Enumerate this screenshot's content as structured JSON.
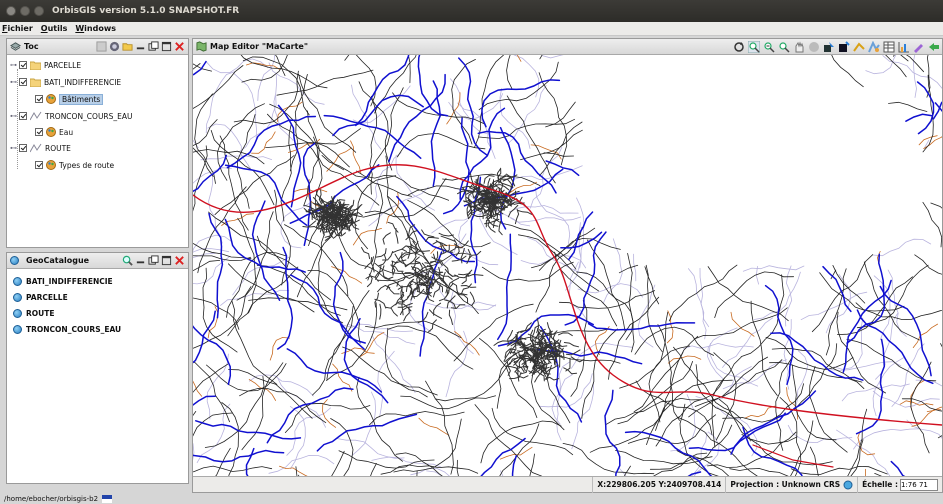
{
  "window": {
    "title": "OrbisGIS version 5.1.0 SNAPSHOT.FR"
  },
  "menu": [
    "Fichier",
    "Outils",
    "Windows"
  ],
  "toc": {
    "title": "Toc",
    "layers": [
      {
        "label": "PARCELLE",
        "level": 0,
        "kind": "folder"
      },
      {
        "label": "BATI_INDIFFERENCIE",
        "level": 0,
        "kind": "folder"
      },
      {
        "label": "Bâtiments",
        "level": 1,
        "kind": "style"
      },
      {
        "label": "TRONCON_COURS_EAU",
        "level": 0,
        "kind": "line"
      },
      {
        "label": "Eau",
        "level": 1,
        "kind": "style"
      },
      {
        "label": "ROUTE",
        "level": 0,
        "kind": "line"
      },
      {
        "label": "Types de route",
        "level": 1,
        "kind": "style"
      }
    ]
  },
  "geocatalogue": {
    "title": "GeoCatalogue",
    "sources": [
      "BATI_INDIFFERENCIE",
      "PARCELLE",
      "ROUTE",
      "TRONCON_COURS_EAU"
    ]
  },
  "map_editor": {
    "title": "Map Editor \"MaCarte\"",
    "tool_icons": [
      "refresh-icon",
      "zoom-in-icon",
      "zoom-out-icon",
      "zoom-extent-icon",
      "pan-icon",
      "info-icon",
      "select-icon",
      "select-area-icon",
      "measure-icon",
      "style-icon",
      "table-icon",
      "chart-icon",
      "draw-icon",
      "export-icon"
    ]
  },
  "status": {
    "coordinates": "X:229806.205 Y:2409708.414",
    "projection": "Projection : Unknown CRS",
    "scale_label": "Échelle :",
    "scale_value": "1:76 71"
  },
  "bottom": {
    "path": "/home/ebocher/orbisgis-b2"
  },
  "colors": {
    "water": "#1010d0",
    "road": "#222222",
    "rail": "#d01020",
    "minor": "#b9b4de",
    "track": "#c86a20",
    "building": "#333333"
  }
}
